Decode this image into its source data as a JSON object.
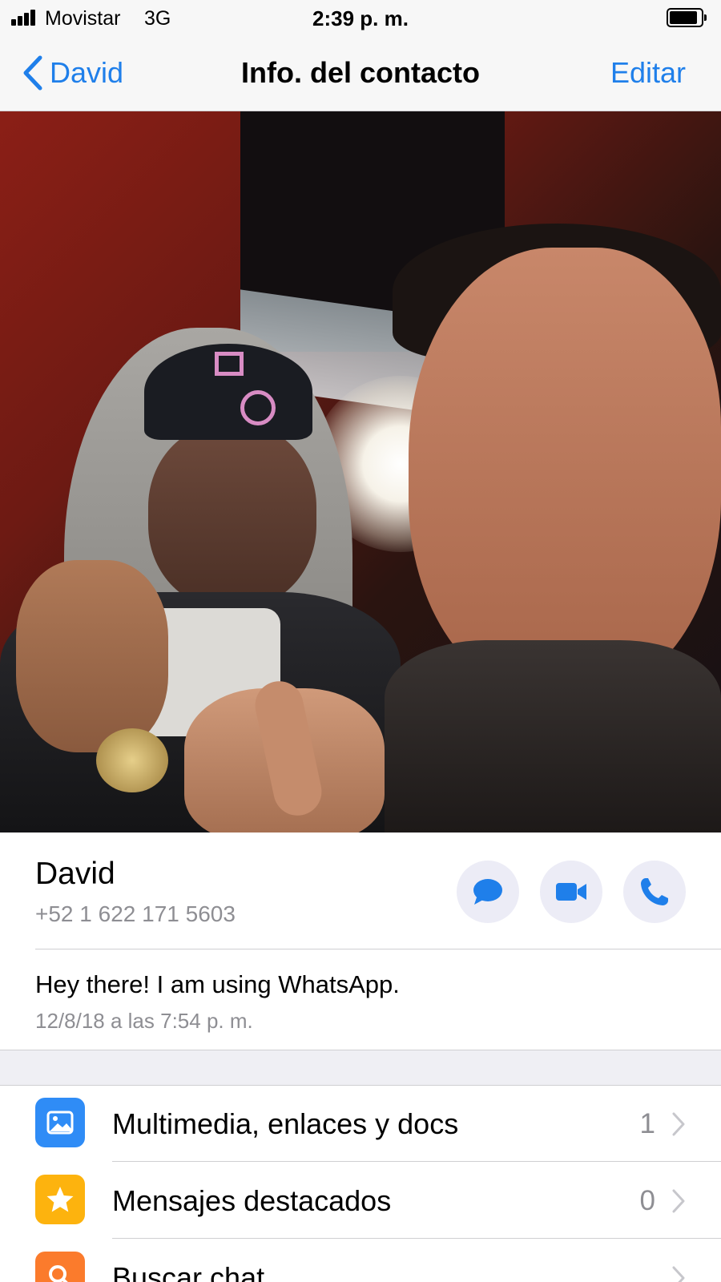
{
  "status_bar": {
    "carrier": "Movistar",
    "network": "3G",
    "time": "2:39 p. m."
  },
  "nav": {
    "back_label": "David",
    "title": "Info. del contacto",
    "edit_label": "Editar"
  },
  "contact": {
    "name": "David",
    "phone": "+52 1 622 171 5603",
    "about": "Hey there! I am using WhatsApp.",
    "about_date": "12/8/18 a las 7:54 p. m."
  },
  "actions": [
    {
      "icon": "message-icon"
    },
    {
      "icon": "video-camera-icon"
    },
    {
      "icon": "phone-icon"
    }
  ],
  "menu": [
    {
      "label": "Multimedia, enlaces y docs",
      "count": "1",
      "icon": "photo-icon",
      "color": "#2f8cf6"
    },
    {
      "label": "Mensajes destacados",
      "count": "0",
      "icon": "star-icon",
      "color": "#fdb30e"
    },
    {
      "label": "Buscar chat",
      "count": "",
      "icon": "search-icon",
      "color": "#fb7b2c"
    }
  ],
  "colors": {
    "accent": "#1f7fea",
    "secondary_text": "#8e8e93",
    "action_button_bg": "#ececf6"
  }
}
